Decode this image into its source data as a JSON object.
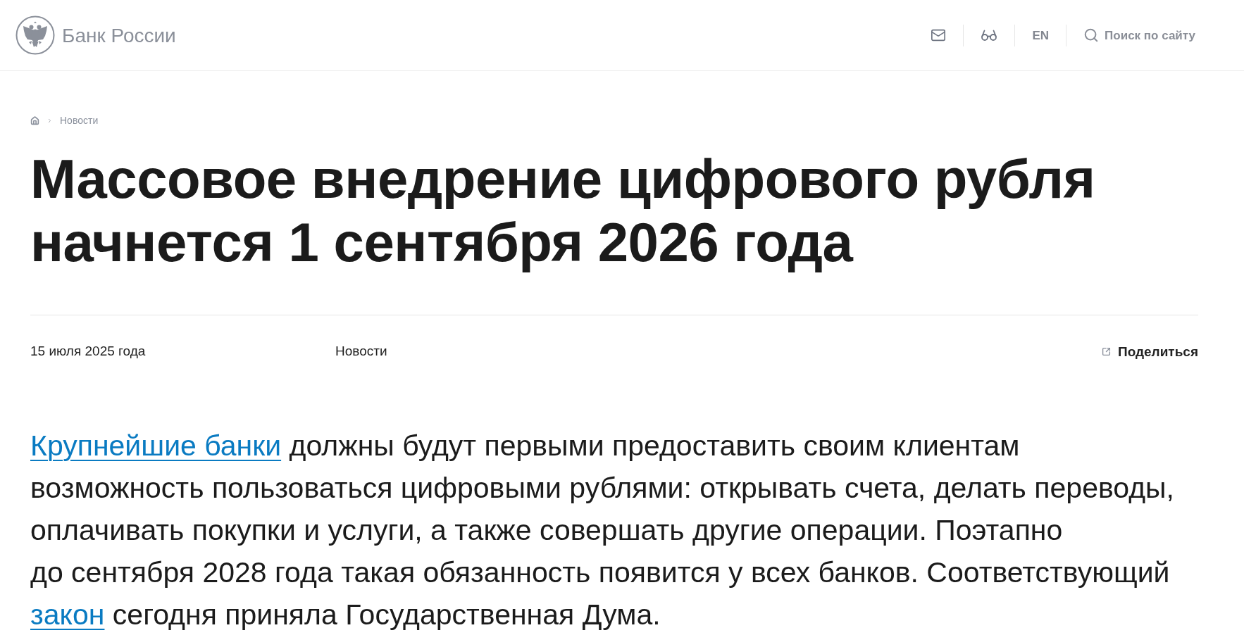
{
  "header": {
    "logo_text": "Банк России",
    "language_link": "EN",
    "search": {
      "label": "Поиск по сайту"
    }
  },
  "breadcrumbs": [
    {
      "label": "Новости"
    }
  ],
  "article": {
    "title": "Массовое внедрение цифрового рубля начнется 1 сентября 2026 года",
    "date": "15 июля 2025 года",
    "category": "Новости",
    "share": "Поделиться",
    "paragraph": [
      {
        "kind": "link",
        "text": "Крупнейшие банки"
      },
      {
        "kind": "text",
        "text": " должны будут первыми предоставить своим клиентам возможность пользоваться цифровыми рублями: открывать счета, делать переводы, оплачивать покупки и услуги, а также совершать другие операции. Поэтапно до сентября 2028 года такая обязанность появится у всех банков. Соответствующий "
      },
      {
        "kind": "link",
        "text": "закон"
      },
      {
        "kind": "text",
        "text": " сегодня приняла Государственная Дума."
      }
    ]
  }
}
